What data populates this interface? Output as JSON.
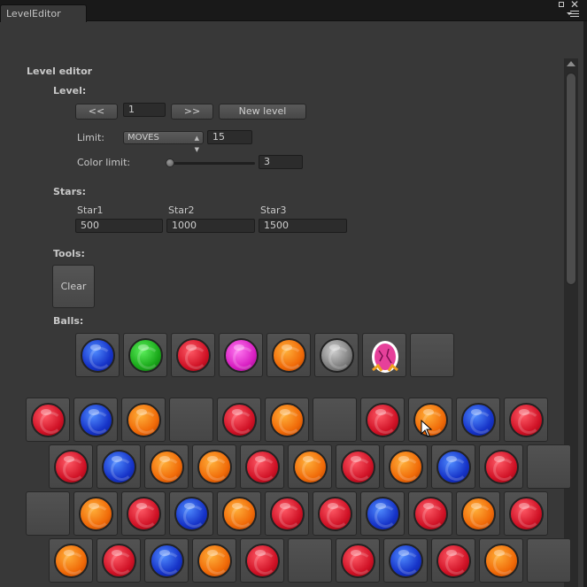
{
  "window": {
    "tab_title": "LevelEditor"
  },
  "editor": {
    "title": "Level editor",
    "level_heading": "Level:",
    "prev_label": "<<",
    "level_value": "1",
    "next_label": ">>",
    "new_level_label": "New level",
    "limit_label": "Limit:",
    "limit_type": "MOVES",
    "limit_value": "15",
    "color_limit_label": "Color limit:",
    "color_limit_value": "3",
    "color_limit_slider_fraction": 0,
    "stars_heading": "Stars:",
    "stars": [
      {
        "label": "Star1",
        "value": "500"
      },
      {
        "label": "Star2",
        "value": "1000"
      },
      {
        "label": "Star3",
        "value": "1500"
      }
    ],
    "tools_heading": "Tools:",
    "clear_label": "Clear",
    "balls_heading": "Balls:",
    "palette": [
      "blue",
      "green",
      "red",
      "pink",
      "orange",
      "gray",
      "egg",
      "empty"
    ]
  },
  "grid": {
    "rows": [
      [
        "red",
        "blue",
        "orange",
        "empty",
        "red",
        "orange",
        "empty",
        "red",
        "orange",
        "blue",
        "red"
      ],
      [
        "red",
        "blue",
        "orange",
        "orange",
        "red",
        "orange",
        "red",
        "orange",
        "blue",
        "red",
        "empty"
      ],
      [
        "empty",
        "orange",
        "red",
        "blue",
        "orange",
        "red",
        "red",
        "blue",
        "red",
        "orange",
        "red"
      ],
      [
        "orange",
        "red",
        "blue",
        "orange",
        "red",
        "empty",
        "red",
        "blue",
        "red",
        "orange",
        "empty"
      ]
    ]
  },
  "colors": {
    "panel_bg": "#383838",
    "tab_bar": "#191919",
    "cell_bg": "#4c4c4c"
  }
}
